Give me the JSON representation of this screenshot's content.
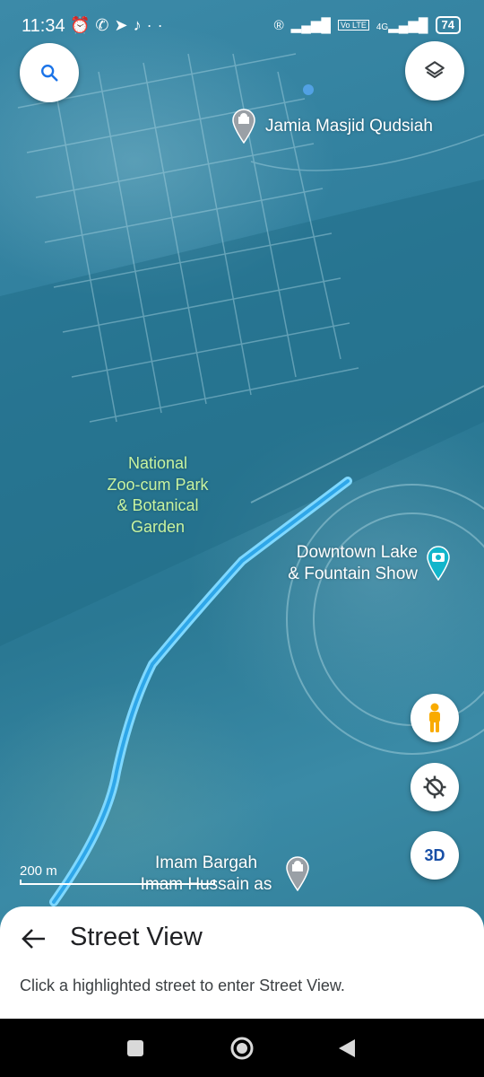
{
  "status_bar": {
    "time": "11:34",
    "notification_icons": [
      "alarm-icon",
      "whatsapp-icon",
      "telegram-icon",
      "tiktok-icon",
      "more-dots-icon"
    ],
    "right_icons": [
      "registered-icon",
      "signal-icon",
      "volte-icon",
      "4g-signal-icon"
    ],
    "network_label": "4G",
    "volte_label": "Vo LTE",
    "battery": "74"
  },
  "map": {
    "places": [
      {
        "name": "Jamia Masjid Qudsiah",
        "icon": "mosque-pin-icon"
      },
      {
        "name": "Downtown Lake & Fountain Show",
        "icon": "camera-pin-icon"
      },
      {
        "name": "Imam Bargah Imam Hussain as",
        "icon": "mosque-pin-icon"
      }
    ],
    "park_label": [
      "National",
      "Zoo-cum Park",
      "& Botanical",
      "Garden"
    ],
    "downtown_lines": [
      "Downtown Lake",
      "& Fountain Show"
    ],
    "imam_lines": [
      "Imam Bargah",
      "Imam Hussain as"
    ],
    "jamia_label": "Jamia Masjid Qudsiah",
    "scale_label": "200 m",
    "highlight_color": "#4fc3ff"
  },
  "controls": {
    "search_icon": "search-icon",
    "layers_icon": "layers-icon",
    "pegman_icon": "pegman-icon",
    "location_icon": "my-location-off-icon",
    "threed_label": "3D"
  },
  "sheet": {
    "title": "Street View",
    "description": "Click a highlighted street to enter Street View."
  },
  "navbar": {
    "buttons": [
      "recents-square-icon",
      "home-circle-icon",
      "back-triangle-icon"
    ]
  },
  "colors": {
    "accent_blue": "#1a73e8",
    "pegman_orange": "#f9ab00",
    "map_label_green": "#c8f3a0"
  }
}
